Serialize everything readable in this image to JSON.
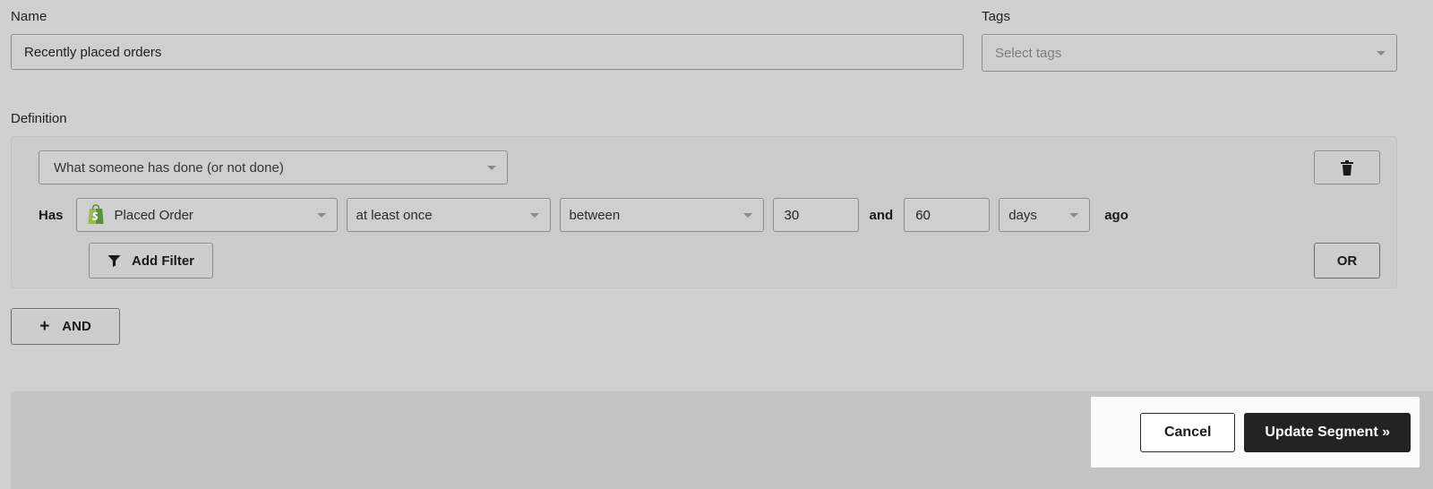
{
  "name_field": {
    "label": "Name",
    "value": "Recently placed orders"
  },
  "tags_field": {
    "label": "Tags",
    "placeholder": "Select tags"
  },
  "definition": {
    "label": "Definition",
    "condition_type": "What someone has done (or not done)",
    "row": {
      "prefix": "Has",
      "metric": "Placed Order",
      "metric_icon": "shopify-bag-icon",
      "frequency": "at least once",
      "operator": "between",
      "value_from": "30",
      "conjunction": "and",
      "value_to": "60",
      "unit": "days",
      "suffix": "ago"
    },
    "add_filter_label": "Add Filter",
    "add_filter_icon": "funnel-icon",
    "delete_icon": "trash-icon",
    "or_label": "OR"
  },
  "and_button": {
    "label": "AND",
    "icon": "plus-icon"
  },
  "footer": {
    "cancel_label": "Cancel",
    "update_label": "Update Segment »"
  },
  "colors": {
    "page_background": "#d0d0d0",
    "panel_background": "#cccccc",
    "input_background": "#cfcfcf",
    "input_border": "#8c8c8c",
    "footer_background": "#c4c4c4",
    "primary_button": "#232323",
    "shopify_green": "#8DB849"
  }
}
